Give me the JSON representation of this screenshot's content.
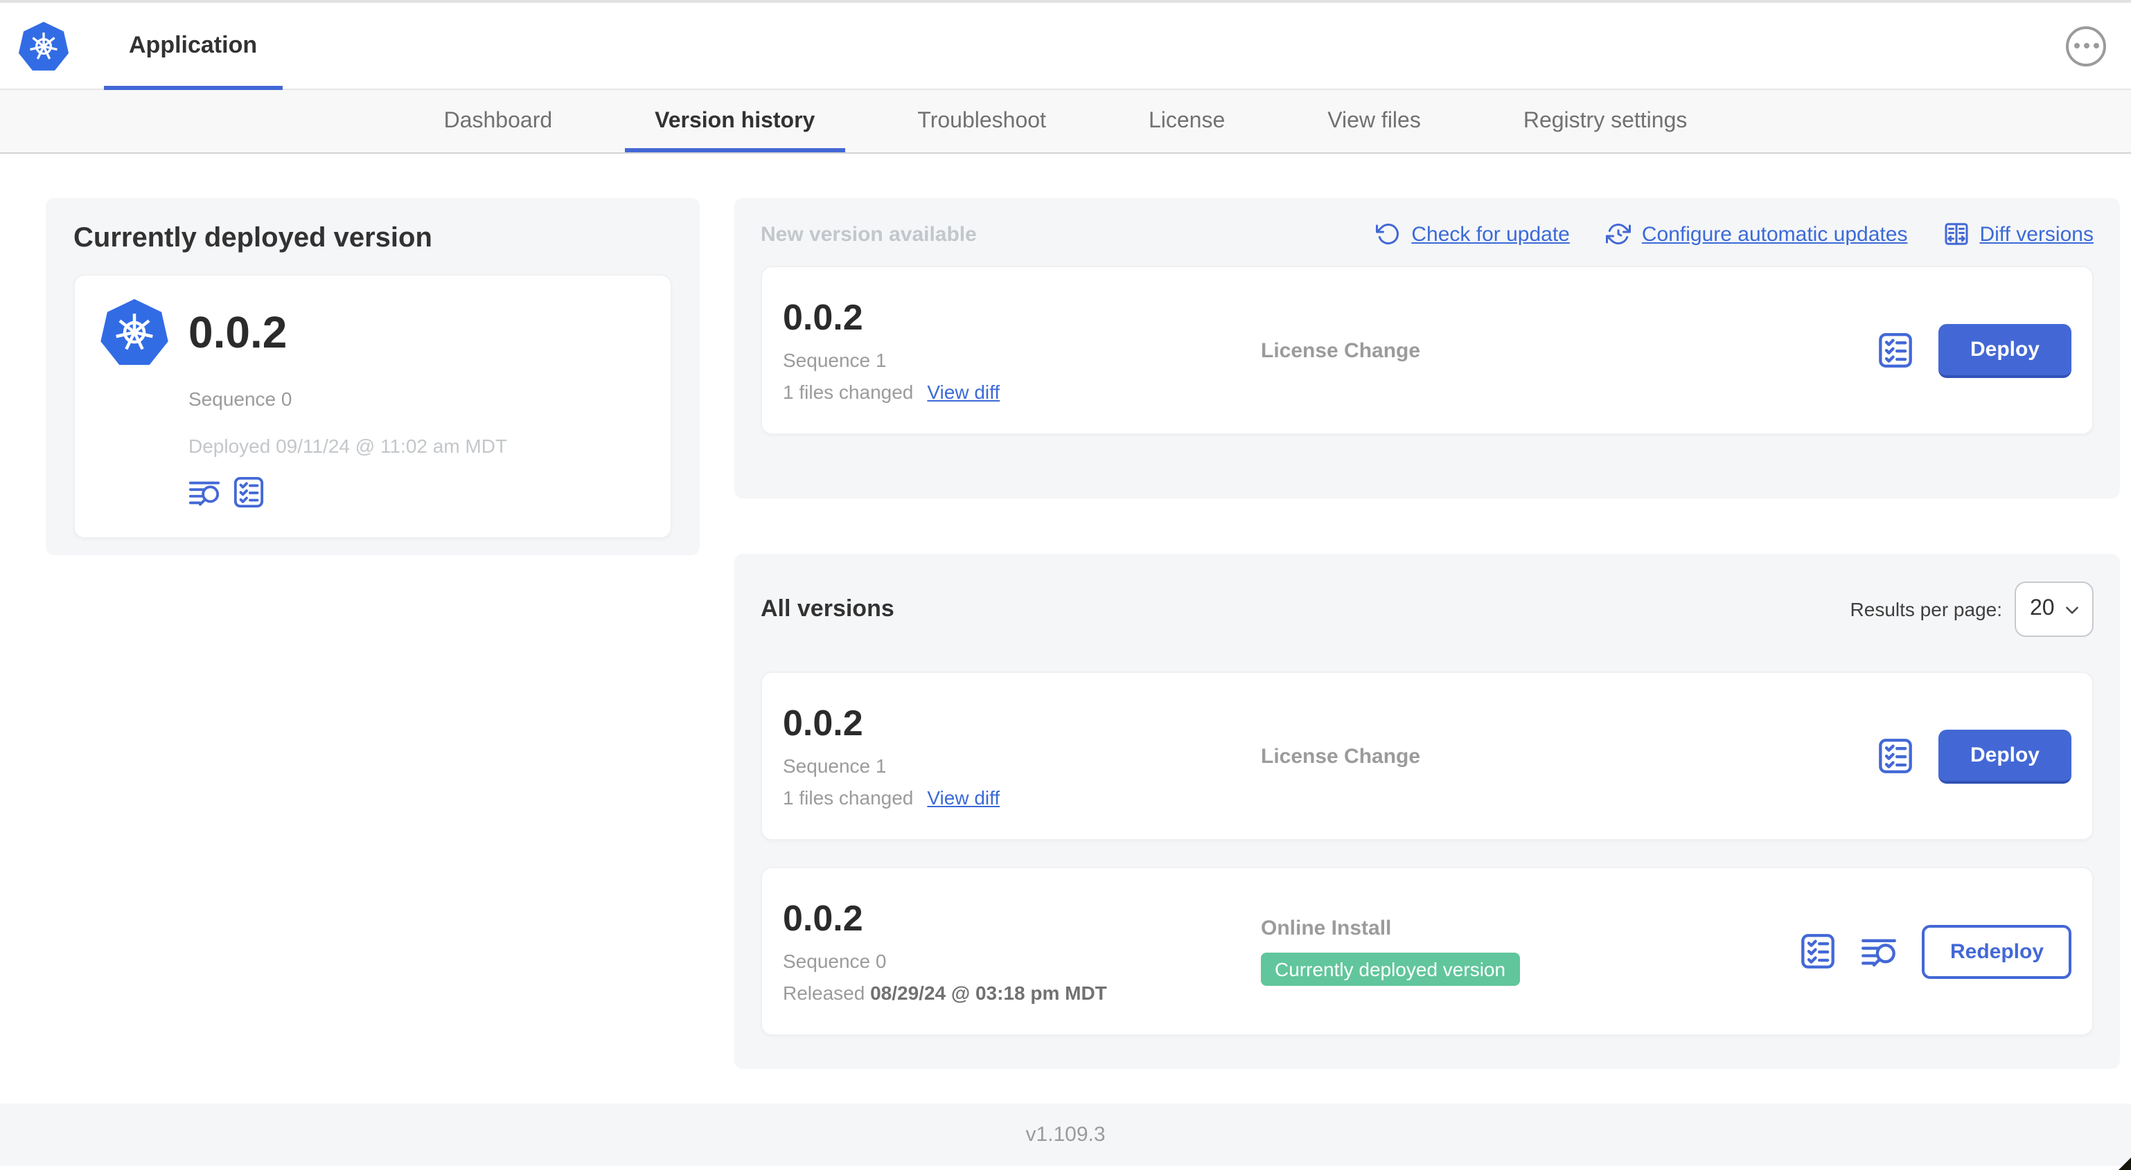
{
  "header": {
    "app_label": "Application",
    "logo_icon": "kubernetes-logo",
    "menu_icon": "ellipsis-icon"
  },
  "nav": {
    "tabs": [
      {
        "label": "Dashboard",
        "active": false
      },
      {
        "label": "Version history",
        "active": true
      },
      {
        "label": "Troubleshoot",
        "active": false
      },
      {
        "label": "License",
        "active": false
      },
      {
        "label": "View files",
        "active": false
      },
      {
        "label": "Registry settings",
        "active": false
      }
    ]
  },
  "current": {
    "title": "Currently deployed version",
    "version": "0.0.2",
    "sequence": "Sequence 0",
    "deployed": "Deployed 09/11/24 @ 11:02 am MDT",
    "icons": [
      "logs-icon",
      "checklist-icon"
    ]
  },
  "newver": {
    "title": "New version available",
    "actions": [
      {
        "label": "Check for update",
        "icon": "refresh-icon"
      },
      {
        "label": "Configure automatic updates",
        "icon": "clock-refresh-icon"
      },
      {
        "label": "Diff versions",
        "icon": "diff-icon"
      }
    ],
    "card": {
      "version": "0.0.2",
      "sequence": "Sequence 1",
      "files_changed": "1 files changed",
      "view_diff": "View diff",
      "source": "License Change",
      "action_label": "Deploy"
    }
  },
  "allver": {
    "title": "All versions",
    "results_label": "Results per page:",
    "results_value": "20",
    "rows": [
      {
        "version": "0.0.2",
        "sequence": "Sequence 1",
        "files_changed": "1 files changed",
        "view_diff": "View diff",
        "source": "License Change",
        "action_label": "Deploy"
      },
      {
        "version": "0.0.2",
        "sequence": "Sequence 0",
        "released_prefix": "Released",
        "released_date": "08/29/24 @ 03:18 pm MDT",
        "source": "Online Install",
        "badge": "Currently deployed version",
        "action_label": "Redeploy"
      }
    ]
  },
  "footer": {
    "version": "v1.109.3"
  },
  "colors": {
    "accent_blue": "#4368d6",
    "link_blue": "#3b6ad8",
    "badge_green": "#61c69b",
    "kubernetes_blue": "#326ce5"
  }
}
